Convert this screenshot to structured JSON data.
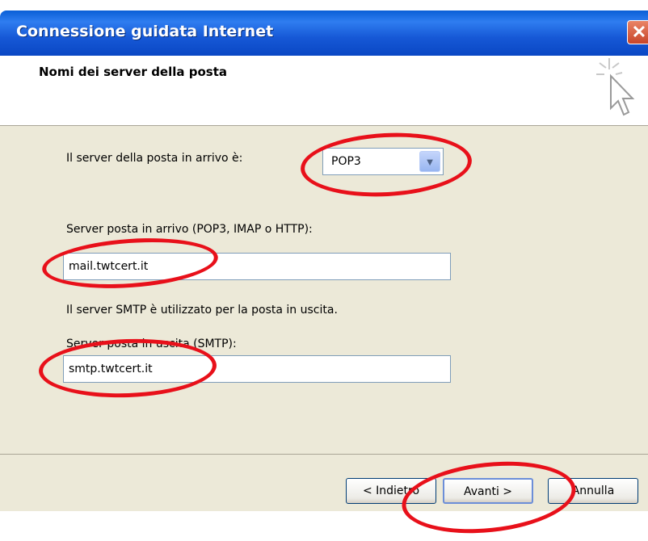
{
  "window": {
    "title": "Connessione guidata Internet",
    "close_glyph": "✕"
  },
  "header": {
    "title": "Nomi dei server della posta",
    "icon": "wizard-cursor-icon"
  },
  "form": {
    "incoming_type_label": "Il server della posta in arrivo è:",
    "incoming_type_value": "POP3",
    "incoming_server_label": "Server posta in arrivo (POP3, IMAP o HTTP):",
    "incoming_server_value": "mail.twtcert.it",
    "smtp_note": "Il server SMTP è utilizzato per la posta in uscita.",
    "outgoing_server_label": "Server posta in uscita (SMTP):",
    "outgoing_server_value": "smtp.twtcert.it"
  },
  "buttons": {
    "back": "< Indietro",
    "next": "Avanti >",
    "cancel": "Annulla"
  },
  "colors": {
    "annotation": "#e8101a",
    "titlebar": "#0a5fd6",
    "panel": "#ece9d8"
  }
}
